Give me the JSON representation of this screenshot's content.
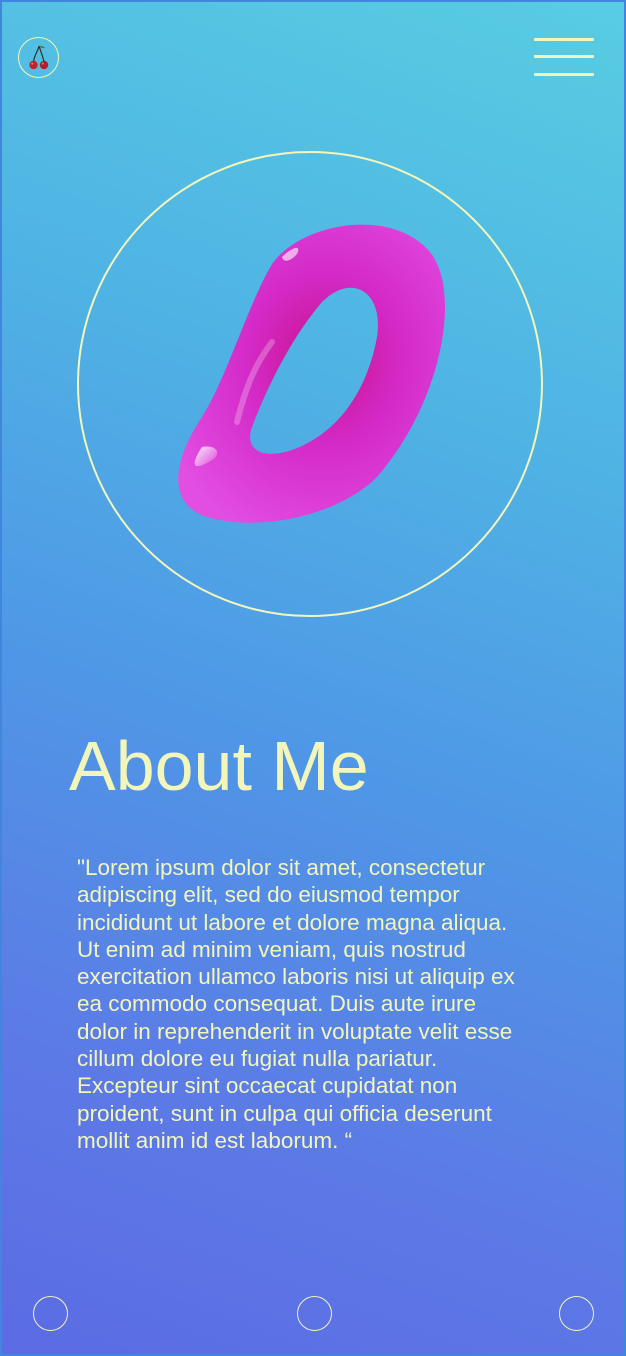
{
  "header": {
    "logo_icon": "cherry-icon",
    "menu_icon": "hamburger-menu-icon"
  },
  "hero": {
    "graphic": "3d-pink-torus-blob",
    "ring": "circle-outline"
  },
  "about": {
    "title": "About Me",
    "body": "\"Lorem ipsum dolor sit amet, consectetur adipiscing elit, sed do eiusmod tempor incididunt ut labore et dolore magna aliqua. Ut enim ad minim veniam, quis nostrud exercitation ullamco laboris nisi ut aliquip ex ea commodo consequat. Duis aute irure dolor in reprehenderit in voluptate velit esse cillum dolore eu fugiat nulla pariatur. Excepteur sint occaecat cupidatat non proident, sunt in culpa qui officia deserunt mollit anim id est laborum. “"
  },
  "bottom_nav": {
    "items": [
      "nav-dot-1",
      "nav-dot-2",
      "nav-dot-3"
    ]
  },
  "colors": {
    "accent": "#f3f6ba",
    "gradient_top": "#58cde2",
    "gradient_bottom": "#5b6be4",
    "blob": "#d530d6",
    "cherry": "#c0242c"
  }
}
